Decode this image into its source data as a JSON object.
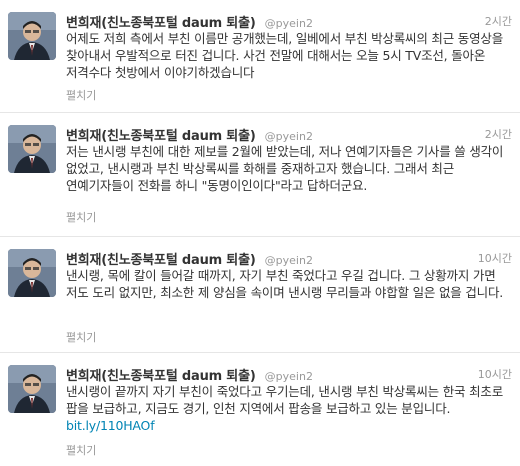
{
  "tweets": [
    {
      "name": "변희재(친노종북포털 daum 퇴출)",
      "handle": "@pyein2",
      "time": "2시간",
      "text": "어제도 저희 측에서 부친 이름만 공개했는데, 일베에서 부친 박상록씨의 최근 동영상을 찾아내서 우발적으로 터진 겁니다. 사건 전말에 대해서는 오늘 5시 TV조선, 돌아온 저격수다 첫방에서 이야기하겠습니다",
      "link": "",
      "expand": "펼치기"
    },
    {
      "name": "변희재(친노종북포털 daum 퇴출)",
      "handle": "@pyein2",
      "time": "2시간",
      "text": "저는 낸시랭 부친에 대한 제보를 2월에 받았는데, 저나 연예기자들은 기사를 쓸 생각이 없었고, 낸시랭과 부친 박상록씨를 화해를 중재하고자 했습니다. 그래서 최근 연예기자들이 전화를 하니 \"동명이인이다\"라고 답하더군요.",
      "link": "",
      "expand": "펼치기"
    },
    {
      "name": "변희재(친노종북포털 daum 퇴출)",
      "handle": "@pyein2",
      "time": "10시간",
      "text": "낸시랭, 목에 칼이 들어갈 때까지, 자기 부친 죽었다고 우길 겁니다. 그 상황까지 가면 저도 도리 없지만, 최소한 제 양심을 속이며 낸시랭 무리들과 야합할 일은 없을 겁니다.",
      "link": "",
      "expand": "펼치기"
    },
    {
      "name": "변희재(친노종북포털 daum 퇴출)",
      "handle": "@pyein2",
      "time": "10시간",
      "text": "낸시랭이 끝까지 자기 부친이 죽었다고 우기는데, 낸시랭 부친 박상록씨는 한국 최초로 팝을 보급하고, 지금도 경기, 인천 지역에서 팝송을 보급하고 있는 분입니다.",
      "link": "bit.ly/110HAOf",
      "expand": "펼치기"
    }
  ]
}
